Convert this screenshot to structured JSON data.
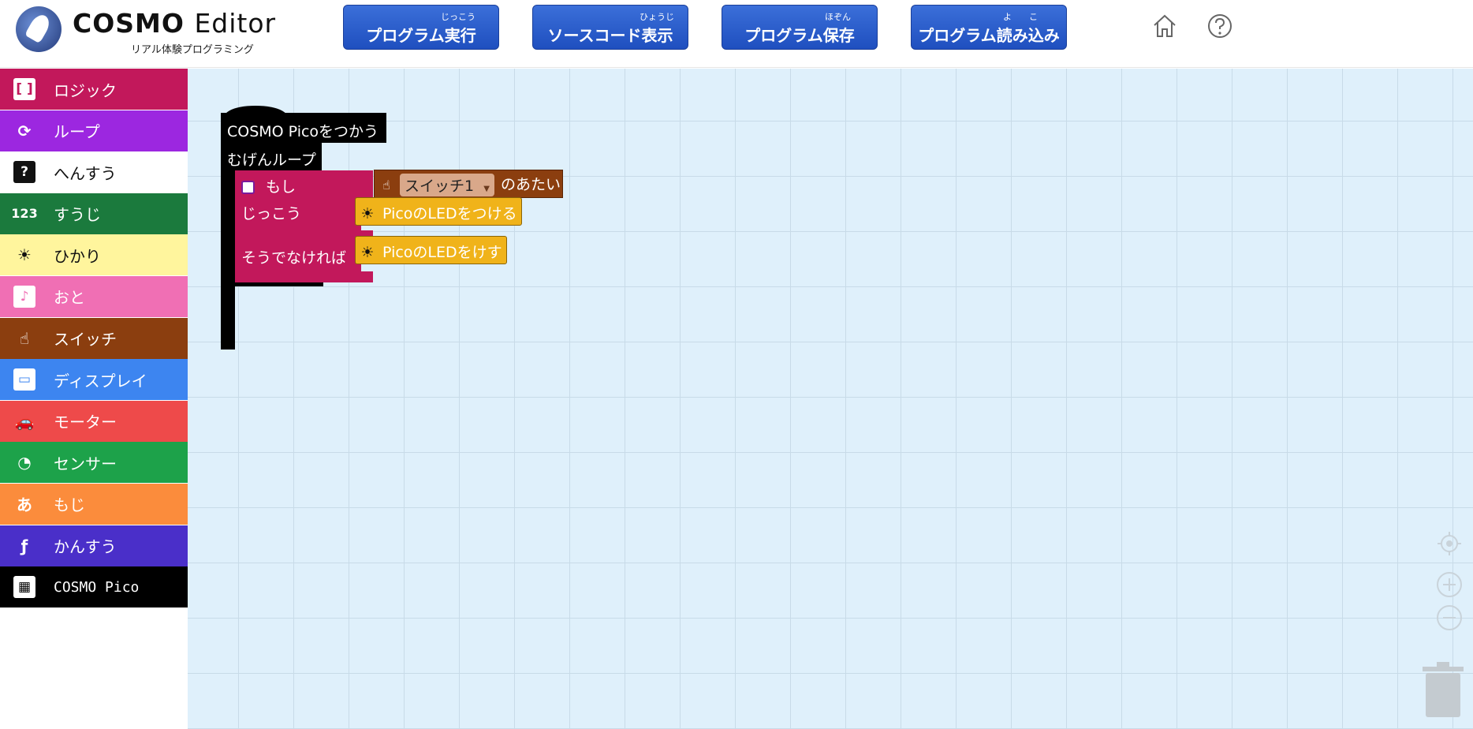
{
  "app": {
    "logo_title_bold": "COSMO",
    "logo_title_light": "Editor",
    "logo_subtitle": "リアル体験プログラミング"
  },
  "header": {
    "buttons": [
      {
        "label": "プログラム実行",
        "ruby": "じっこう"
      },
      {
        "label": "ソースコード表示",
        "ruby": "ひょうじ"
      },
      {
        "label": "プログラム保存",
        "ruby": "ほぞん"
      },
      {
        "label": "プログラム読み込み",
        "ruby": "よ　　こ"
      }
    ],
    "icons": [
      "home-icon",
      "help-icon"
    ]
  },
  "sidebar": {
    "items": [
      {
        "label": "ロジック",
        "icon": "logic-bracket-icon",
        "glyph": "[ ]",
        "bg": "#c2185b",
        "fg": "#ffffff"
      },
      {
        "label": "ループ",
        "icon": "loop-arrows-icon",
        "glyph": "⟳",
        "bg": "#9c27e0",
        "fg": "#ffffff"
      },
      {
        "label": "へんすう",
        "icon": "variable-question-icon",
        "glyph": "?",
        "bg": "#ffffff",
        "fg": "#111111"
      },
      {
        "label": "すうじ",
        "icon": "number-123-icon",
        "glyph": "123",
        "bg": "#1b7a3d",
        "fg": "#ffffff"
      },
      {
        "label": "ひかり",
        "icon": "light-bulb-icon",
        "glyph": "☀",
        "bg": "#fff59d",
        "fg": "#111111"
      },
      {
        "label": "おと",
        "icon": "music-note-icon",
        "glyph": "♪",
        "bg": "#f06fb4",
        "fg": "#ffffff"
      },
      {
        "label": "スイッチ",
        "icon": "switch-touch-icon",
        "glyph": "☝",
        "bg": "#8b3e0f",
        "fg": "#ffffff"
      },
      {
        "label": "ディスプレイ",
        "icon": "display-monitor-icon",
        "glyph": "▭",
        "bg": "#3d85f0",
        "fg": "#ffffff"
      },
      {
        "label": "モーター",
        "icon": "car-motor-icon",
        "glyph": "🚗",
        "bg": "#ee4a4a",
        "fg": "#ffffff"
      },
      {
        "label": "センサー",
        "icon": "gauge-sensor-icon",
        "glyph": "◔",
        "bg": "#1da24a",
        "fg": "#ffffff"
      },
      {
        "label": "もじ",
        "icon": "text-a-icon",
        "glyph": "あ",
        "bg": "#fb8c3c",
        "fg": "#ffffff"
      },
      {
        "label": "かんすう",
        "icon": "function-f-icon",
        "glyph": "ƒ",
        "bg": "#4a2fc9",
        "fg": "#ffffff"
      },
      {
        "label": "COSMO Pico",
        "icon": "chip-board-icon",
        "glyph": "▦",
        "bg": "#000000",
        "fg": "#ffffff"
      }
    ]
  },
  "blocks": {
    "start_hat": "COSMO Picoをつかう",
    "forever_loop": "むげんループ",
    "if_label": "もし",
    "then_label": "じっこう",
    "else_label": "そうでなければ",
    "switch_dropdown": "スイッチ1",
    "switch_value_suffix": "のあたい",
    "led_on": "PicoのLEDをつける",
    "led_off": "PicoのLEDをけす",
    "colors": {
      "start": "#000000",
      "logic": "#c2185b",
      "switch": "#8b3e0f",
      "light": "#f0b31a"
    }
  },
  "workspace_controls": [
    "recenter-icon",
    "zoom-in-icon",
    "zoom-out-icon",
    "trash-icon"
  ]
}
